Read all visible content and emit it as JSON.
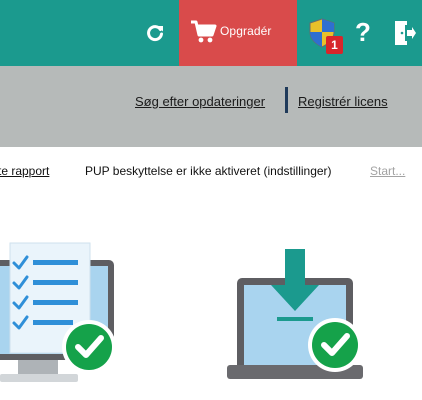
{
  "topbar": {
    "refresh_icon": "refresh-icon",
    "upgrade_label": "Opgradér",
    "cart_icon": "shopping-cart-icon",
    "shield_icon": "uac-shield-icon",
    "notification_count": "1",
    "help_label": "?",
    "exit_icon": "exit-door-icon",
    "colors": {
      "bar": "#1b9a8e",
      "upgrade": "#d94b4b",
      "badge": "#d7262b"
    }
  },
  "links": {
    "check_updates": "Søg efter opdateringer",
    "register_license": "Registrér licens"
  },
  "status": {
    "report_link": "te rapport",
    "pup_text": "PUP beskyttelse er ikke aktiveret (indstillinger)",
    "start_link": "Start..."
  },
  "illustrations": {
    "left": "monitor-checklist-check-icon",
    "right": "laptop-download-check-icon"
  }
}
